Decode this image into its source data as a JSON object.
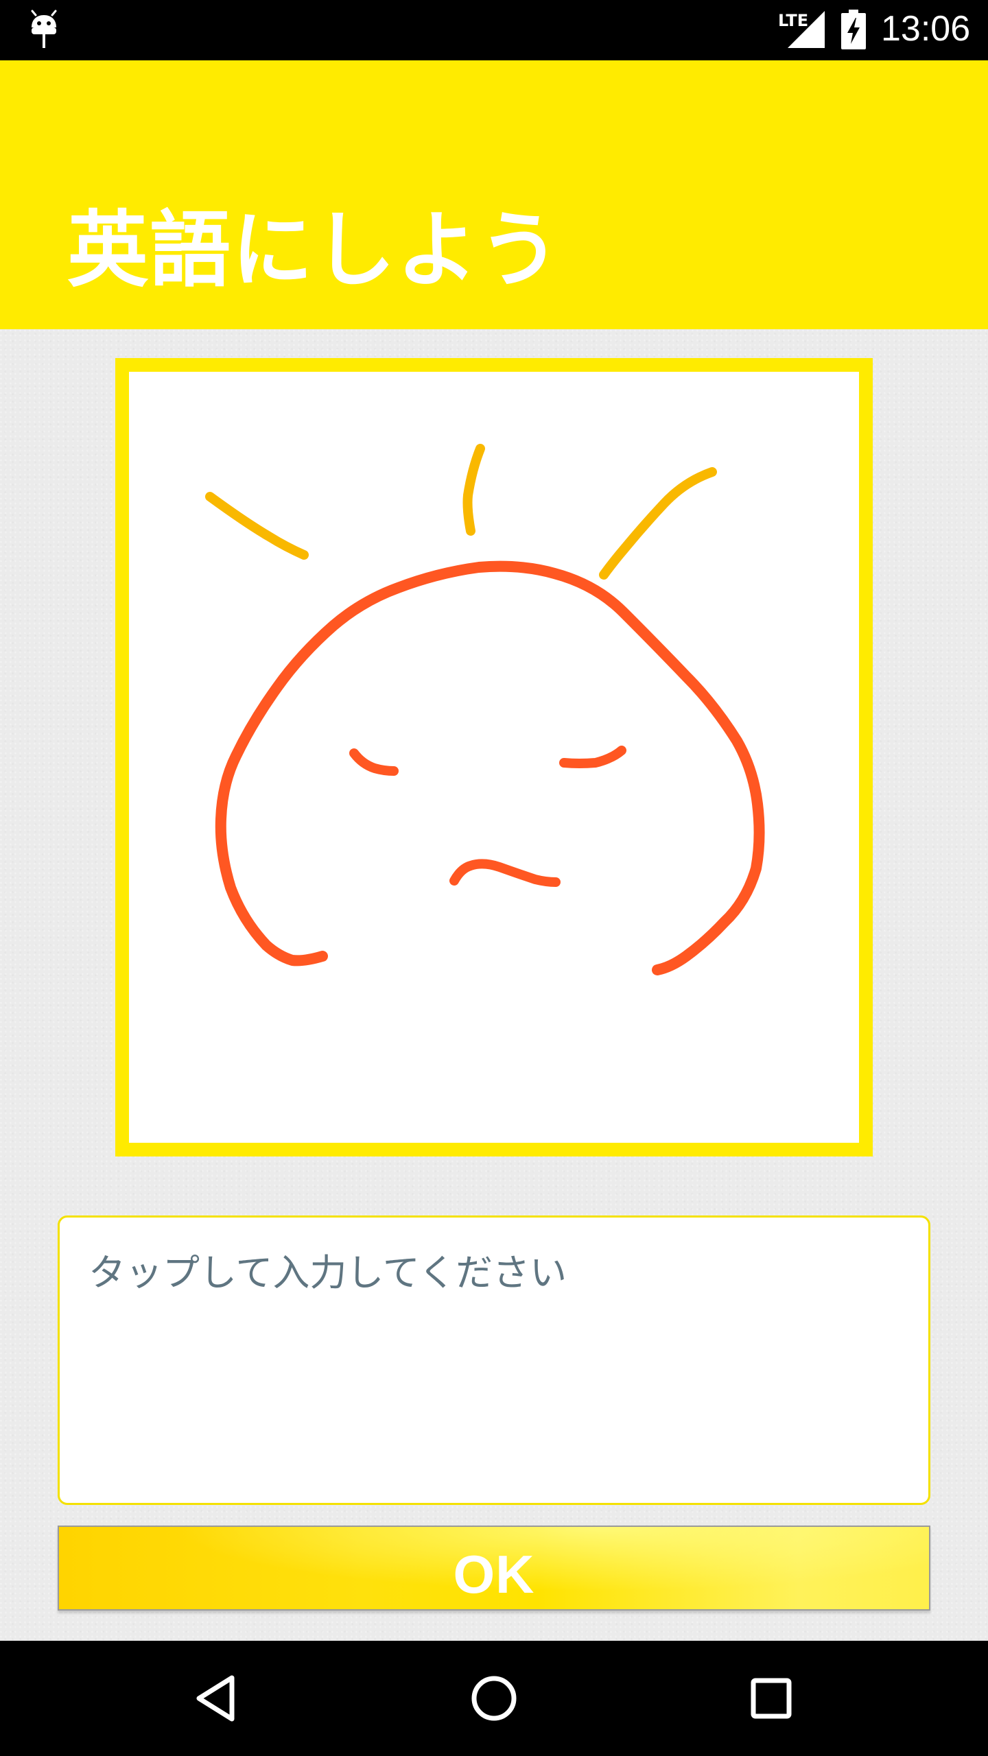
{
  "status_bar": {
    "time": "13:06",
    "network": "LTE",
    "icons": [
      "android-debug-icon",
      "signal-icon",
      "battery-charging-icon"
    ]
  },
  "header": {
    "title": "英語にしよう",
    "background_color": "#ffeb00"
  },
  "drawing": {
    "frame_color": "#ffeb00",
    "stroke_colors": {
      "face": "#ff5722",
      "rays": "#f9b800"
    }
  },
  "answer": {
    "placeholder": "タップして入力してください",
    "value": ""
  },
  "ok_button": {
    "label": "OK"
  },
  "nav_bar": {
    "icons": [
      "back-icon",
      "home-icon",
      "recent-apps-icon"
    ]
  }
}
